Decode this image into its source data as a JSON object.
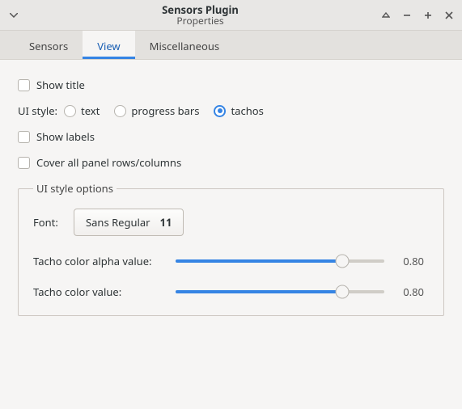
{
  "window": {
    "title": "Sensors Plugin",
    "subtitle": "Properties"
  },
  "tabs": {
    "sensors": "Sensors",
    "view": "View",
    "misc": "Miscellaneous"
  },
  "view": {
    "show_title": "Show title",
    "ui_style_label": "UI style:",
    "style_text": "text",
    "style_progress": "progress bars",
    "style_tachos": "tachos",
    "show_labels": "Show labels",
    "cover_all": "Cover all panel rows/columns",
    "options_legend": "UI style options",
    "font_label": "Font:",
    "font_name": "Sans Regular",
    "font_size": "11",
    "alpha_label": "Tacho color alpha value:",
    "alpha_value": "0.80",
    "color_label": "Tacho color value:",
    "color_value": "0.80"
  }
}
